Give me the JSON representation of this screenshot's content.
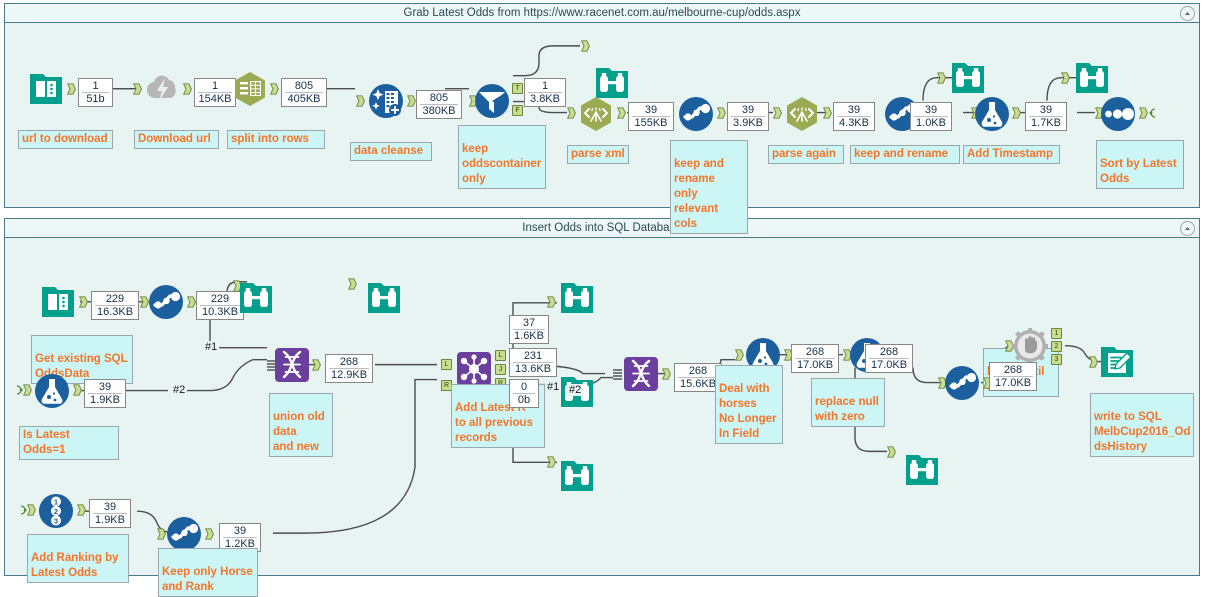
{
  "app": {
    "canvas_background": "#ffffff",
    "container_fill": "#e8f4f2",
    "container_border": "#4a7a87",
    "annotation_text_color": "#f4762a",
    "annotation_fill": "#ccf5f5",
    "accent_teal": "#00a499",
    "accent_blue": "#1b5f9e",
    "accent_olive": "#9aab54",
    "accent_purple": "#6b3f9e",
    "anchor_green": "#c9dd8f"
  },
  "containers": [
    {
      "id": "container-grab-odds",
      "title": "Grab Latest Odds from https://www.racenet.com.au/melbourne-cup/odds.aspx",
      "collapse_icon": "chevron-up-circle-icon"
    },
    {
      "id": "container-insert-sql",
      "title": "Insert Odds into SQL Database",
      "collapse_icon": "chevron-up-circle-icon"
    }
  ],
  "top_workflow": {
    "tools": [
      {
        "name": "input-data-tool",
        "icon": "input-data-icon",
        "label": "url to download"
      },
      {
        "name": "download-tool",
        "icon": "download-icon",
        "label": "Download url"
      },
      {
        "name": "text-to-columns-tool",
        "icon": "text-to-columns-icon",
        "label": "split into rows"
      },
      {
        "name": "data-cleanse-tool",
        "icon": "data-cleanse-icon",
        "label": "data cleanse"
      },
      {
        "name": "filter-tool",
        "icon": "filter-icon",
        "label": "keep\noddscontainer\nonly"
      },
      {
        "name": "browse-tool-1",
        "icon": "browse-icon",
        "label": ""
      },
      {
        "name": "xml-parse-tool-1",
        "icon": "xml-parse-icon",
        "label": "parse xml"
      },
      {
        "name": "select-tool-1",
        "icon": "select-icon",
        "label": "keep and\nrename\nonly relevant\ncols"
      },
      {
        "name": "xml-parse-tool-2",
        "icon": "xml-parse-icon",
        "label": "parse again"
      },
      {
        "name": "select-tool-2",
        "icon": "select-icon",
        "label": "keep and rename"
      },
      {
        "name": "browse-tool-2",
        "icon": "browse-icon",
        "label": ""
      },
      {
        "name": "formula-tool-1",
        "icon": "formula-icon",
        "label": "Add Timestamp"
      },
      {
        "name": "browse-tool-3",
        "icon": "browse-icon",
        "label": ""
      },
      {
        "name": "sort-tool",
        "icon": "sort-icon",
        "label": "Sort by Latest\nOdds"
      }
    ],
    "annotations": {
      "url_to_download": "url to download",
      "download_url": "Download url",
      "split_into_rows": "split into rows",
      "data_cleanse": "data cleanse",
      "keep_oddscontainer": "keep\noddscontainer\nonly",
      "parse_xml": "parse xml",
      "keep_rename_relevant": "keep and\nrename\nonly relevant\ncols",
      "parse_again": "parse again",
      "keep_and_rename": "keep and rename",
      "add_timestamp": "Add Timestamp",
      "sort_by_latest_odds": "Sort by Latest\nOdds"
    },
    "record_counts": [
      {
        "name": "rc-url",
        "records": "1",
        "size": "51b"
      },
      {
        "name": "rc-download",
        "records": "1",
        "size": "154KB"
      },
      {
        "name": "rc-split",
        "records": "805",
        "size": "405KB"
      },
      {
        "name": "rc-cleanse",
        "records": "805",
        "size": "380KB"
      },
      {
        "name": "rc-filter-t",
        "records": "1",
        "size": "3.8KB"
      },
      {
        "name": "rc-parsexml",
        "records": "39",
        "size": "155KB"
      },
      {
        "name": "rc-select1",
        "records": "39",
        "size": "3.9KB"
      },
      {
        "name": "rc-parseagain",
        "records": "39",
        "size": "4.3KB"
      },
      {
        "name": "rc-select2",
        "records": "39",
        "size": "1.0KB"
      },
      {
        "name": "rc-formula",
        "records": "39",
        "size": "1.7KB"
      }
    ],
    "anchor_labels": {
      "filter_true": "T",
      "filter_false": "F"
    }
  },
  "bottom_workflow": {
    "annotations": {
      "get_existing_sql": "Get existing SQL\nOddsData",
      "is_latest_odds": "Is Latest Odds=1",
      "add_ranking": "Add Ranking by\nLatest Odds",
      "keep_horse_rank": "Keep only Horse\nand Rank",
      "union_old_new": "union old\ndata\nand new",
      "add_latest_to_prev": "Add Latest R\nto all previous\nrecords",
      "deal_with_horses": "Deal with\nhorses\nNo Longer\nIn Field",
      "replace_null": "replace null\nwith zero",
      "block_until_done": "block until\ndone",
      "write_to_sql": "write to SQL\nMelbCup2016_Od\ndsHistory"
    },
    "record_counts": [
      {
        "name": "rc-sql-input",
        "records": "229",
        "size": "16.3KB"
      },
      {
        "name": "rc-sql-select",
        "records": "229",
        "size": "10.3KB"
      },
      {
        "name": "rc-latest-odds",
        "records": "39",
        "size": "1.9KB"
      },
      {
        "name": "rc-recordid",
        "records": "39",
        "size": "1.9KB"
      },
      {
        "name": "rc-keep-horse",
        "records": "39",
        "size": "1.2KB"
      },
      {
        "name": "rc-union-1",
        "records": "268",
        "size": "12.9KB"
      },
      {
        "name": "rc-join-left",
        "records": "37",
        "size": "1.6KB"
      },
      {
        "name": "rc-join-join",
        "records": "231",
        "size": "13.6KB"
      },
      {
        "name": "rc-join-right",
        "records": "0",
        "size": "0b"
      },
      {
        "name": "rc-union-2",
        "records": "268",
        "size": "15.6KB"
      },
      {
        "name": "rc-formula-deal",
        "records": "268",
        "size": "17.0KB"
      },
      {
        "name": "rc-formula-null",
        "records": "268",
        "size": "17.0KB"
      },
      {
        "name": "rc-select-final",
        "records": "268",
        "size": "17.0KB"
      }
    ],
    "connection_labels": {
      "union1_in1": "#1",
      "union1_in2": "#2",
      "union2_in1": "#1",
      "union2_in2": "#2"
    },
    "anchor_labels": {
      "join_left_in": "L",
      "join_right_in": "R",
      "join_left_out": "L",
      "join_join_out": "J",
      "join_right_out": "R",
      "block_out_1": "1",
      "block_out_2": "2",
      "block_out_3": "3"
    },
    "tools": [
      {
        "name": "input-data-tool-sql",
        "icon": "input-data-icon"
      },
      {
        "name": "select-tool-sql",
        "icon": "select-icon"
      },
      {
        "name": "browse-tool-4",
        "icon": "browse-icon"
      },
      {
        "name": "filter-tool-latest",
        "icon": "formula-icon"
      },
      {
        "name": "record-id-tool",
        "icon": "record-id-icon"
      },
      {
        "name": "select-tool-horse",
        "icon": "select-icon"
      },
      {
        "name": "union-tool-1",
        "icon": "union-icon"
      },
      {
        "name": "browse-tool-5",
        "icon": "browse-icon"
      },
      {
        "name": "join-tool",
        "icon": "join-icon"
      },
      {
        "name": "browse-tool-6",
        "icon": "browse-icon"
      },
      {
        "name": "browse-tool-7",
        "icon": "browse-icon"
      },
      {
        "name": "browse-tool-8",
        "icon": "browse-icon"
      },
      {
        "name": "union-tool-2",
        "icon": "union-icon"
      },
      {
        "name": "formula-tool-deal",
        "icon": "formula-icon"
      },
      {
        "name": "formula-tool-null",
        "icon": "formula-icon"
      },
      {
        "name": "browse-tool-9",
        "icon": "browse-icon"
      },
      {
        "name": "select-tool-final",
        "icon": "select-icon"
      },
      {
        "name": "block-until-done-tool",
        "icon": "block-until-done-icon"
      },
      {
        "name": "output-data-tool",
        "icon": "output-data-icon"
      }
    ]
  }
}
